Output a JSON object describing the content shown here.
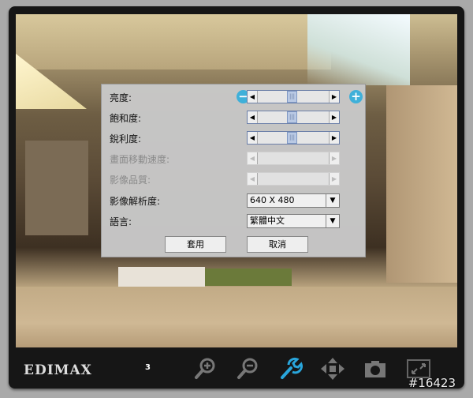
{
  "settings": {
    "brightness_label": "亮度:",
    "saturation_label": "飽和度:",
    "sharpness_label": "銳利度:",
    "pan_speed_label": "畫面移動速度:",
    "quality_label": "影像品質:",
    "resolution_label": "影像解析度:",
    "resolution_value": "640 X 480",
    "language_label": "語言:",
    "language_value": "繁體中文",
    "apply_label": "套用",
    "cancel_label": "取消",
    "brightness_value": 0.5,
    "saturation_value": 0.5,
    "sharpness_value": 0.5
  },
  "toolbar": {
    "logo": "EDIMAX",
    "count": "3",
    "icons": [
      "zoom-in-icon",
      "zoom-out-icon",
      "wrench-icon",
      "move-icon",
      "camera-icon",
      "fullscreen-icon"
    ],
    "active_color": "#29a6dc"
  },
  "watermark": "#16423"
}
